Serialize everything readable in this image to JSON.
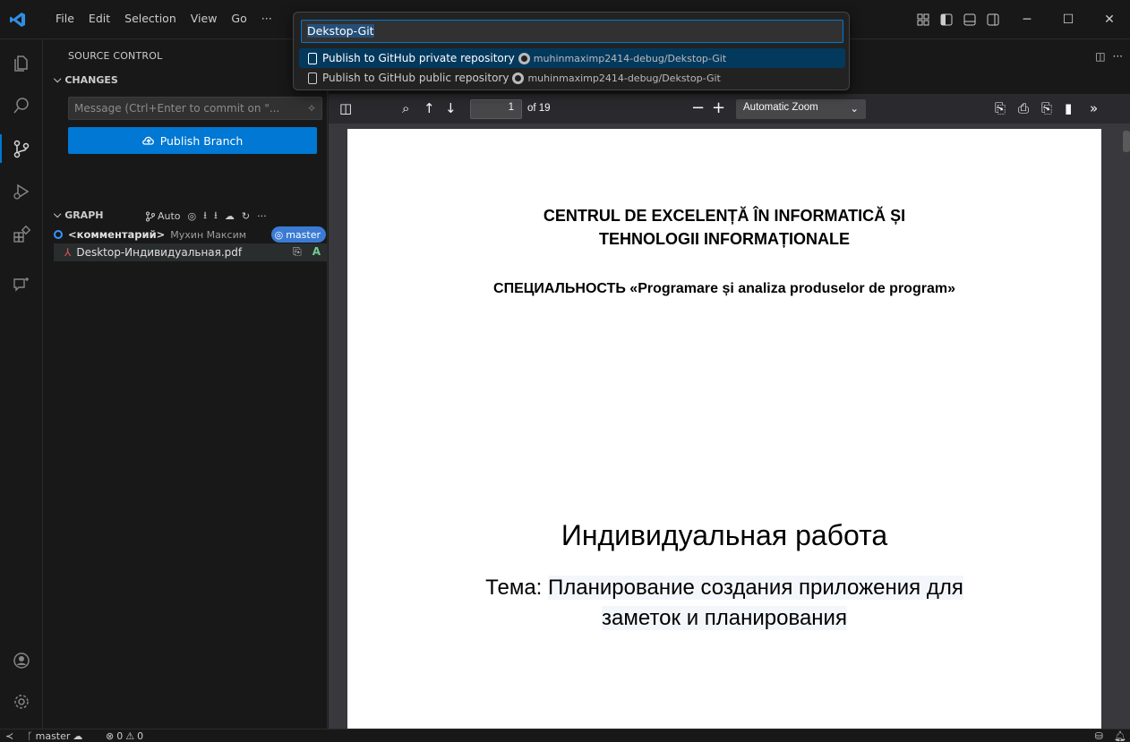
{
  "menu": {
    "items": [
      "File",
      "Edit",
      "Selection",
      "View",
      "Go",
      "···"
    ]
  },
  "quick_pick": {
    "input_selected": "Dekstop-Git",
    "items": [
      {
        "label": "Publish to GitHub private repository",
        "description": "muhinmaximp2414-debug/Dekstop-Git",
        "active": true
      },
      {
        "label": "Publish to GitHub public repository",
        "description": "muhinmaximp2414-debug/Dekstop-Git",
        "active": false
      }
    ]
  },
  "sidebar": {
    "title": "SOURCE CONTROL",
    "changes_label": "CHANGES",
    "commit_placeholder": "Message (Ctrl+Enter to commit on \"...",
    "publish_label": "Publish Branch",
    "graph": {
      "label": "GRAPH",
      "auto_label": "Auto",
      "commit": {
        "message": "<комментарий>",
        "author": "Мухин Максим",
        "branch": "master"
      },
      "file": {
        "name": "Desktop-Индивидуальная.pdf",
        "status": "A"
      }
    }
  },
  "pdf": {
    "page_number": "1",
    "page_of": "of 19",
    "zoom": "Automatic Zoom",
    "heading1_line1": "CENTRUL DE EXCELENȚĂ ÎN INFORMATICĂ ȘI",
    "heading1_line2": "TEHNOLOGII INFORMAȚIONALE",
    "specialty_prefix": "СПЕЦИАЛЬНОСТЬ",
    "specialty_name": "«Programare și analiza produselor de program»",
    "title": "Индивидуальная работа",
    "topic_label": "Тема:",
    "topic_line1": "Планирование создания приложения для",
    "topic_line2": "заметок и планирования"
  },
  "statusbar": {
    "branch": "master",
    "errors": "0",
    "warnings": "0"
  },
  "colors": {
    "accent": "#0078d4",
    "branch_badge": "#3b7bd4",
    "added": "#73c991"
  }
}
